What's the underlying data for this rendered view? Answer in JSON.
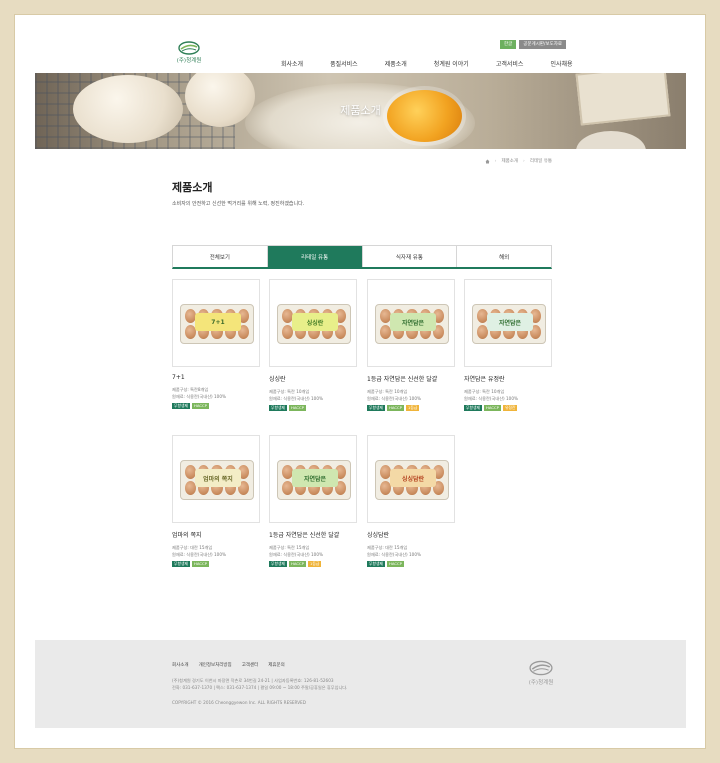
{
  "header": {
    "logo_text": "(주)청계원",
    "util": [
      "한글",
      "공문게시판/보도자료"
    ],
    "nav": [
      "회사소개",
      "품질서비스",
      "제품소개",
      "청계원 이야기",
      "고객서비스",
      "인사채용"
    ]
  },
  "hero": {
    "title": "제품소개"
  },
  "breadcrumb": {
    "home_icon": "home-icon",
    "items": [
      "제품소개",
      "리테일 유통"
    ]
  },
  "page": {
    "title": "제품소개",
    "description": "소비자의 안전하고 신선한 먹거리를 위해 노력, 정진하겠습니다."
  },
  "tabs": [
    {
      "label": "전체보기",
      "active": false
    },
    {
      "label": "리테일 유통",
      "active": true
    },
    {
      "label": "식자재 유통",
      "active": false
    },
    {
      "label": "해외",
      "active": false
    }
  ],
  "colors": {
    "accent": "#1f7a5c",
    "badge_green": "#1f7a5c",
    "badge_lightgreen": "#7cb65c",
    "badge_yellow": "#f0b43a"
  },
  "products": [
    {
      "name": "7+1",
      "info1": "제품구성: 특란8개입",
      "info2": "원재료: 식용란(국내산) 100%",
      "badges": [
        "무항생제",
        "HACCP"
      ],
      "label": "7+1",
      "label_bg": "#f4e57a",
      "label_color": "#3c6a2a"
    },
    {
      "name": "싱싱란",
      "info1": "제품구성: 특란 10개입",
      "info2": "원재료: 식용란(국내산) 100%",
      "badges": [
        "무항생제",
        "HACCP"
      ],
      "label": "싱싱란",
      "label_bg": "#e8ef8a",
      "label_color": "#3f7a23"
    },
    {
      "name": "1등급 자연담은 신선한 달걀",
      "info1": "제품구성: 특란 10개입",
      "info2": "원재료: 식용란(국내산) 100%",
      "badges": [
        "무항생제",
        "HACCP",
        "1등급"
      ],
      "label": "자연담은",
      "label_bg": "#cfe7b0",
      "label_color": "#2c6b2c"
    },
    {
      "name": "자연담은 유정란",
      "info1": "제품구성: 특란 10개입",
      "info2": "원재료: 식용란(국내산) 100%",
      "badges": [
        "무항생제",
        "HACCP",
        "유정란"
      ],
      "label": "자연담은",
      "label_bg": "#dff0e4",
      "label_color": "#2c6b2c"
    },
    {
      "name": "엄마의 쪽지",
      "info1": "제품구성: 대란 15개입",
      "info2": "원재료: 식용란(국내산) 100%",
      "badges": [
        "무항생제",
        "HACCP"
      ],
      "label": "엄마의 쪽지",
      "label_bg": "#f3edc6",
      "label_color": "#6b6a2a"
    },
    {
      "name": "1등급 자연담은 신선한 달걀",
      "info1": "제품구성: 특란 15개입",
      "info2": "원재료: 식용란(국내산) 100%",
      "badges": [
        "무항생제",
        "HACCP",
        "1등급"
      ],
      "label": "자연담은",
      "label_bg": "#cfe7b0",
      "label_color": "#2c6b2c"
    },
    {
      "name": "싱싱담란",
      "info1": "제품구성: 대란 15개입",
      "info2": "원재료: 식용란(국내산) 100%",
      "badges": [
        "무항생제",
        "HACCP"
      ],
      "label": "싱싱담란",
      "label_bg": "#f4d9a6",
      "label_color": "#b4421f"
    }
  ],
  "footer": {
    "links": [
      "회사소개",
      "개인정보처리방침",
      "고객센터",
      "제휴문의"
    ],
    "address": "(주)청계원 경기도 이천시 마장면 작촌로 34번길 24-21 | 사업자등록번호: 126-81-52603",
    "contact": "전화: 031-637-1370 | 팩스: 031-637-1374 | 평일 09:00 ~ 18:00 주말/공휴일은 휴무입니다.",
    "copyright": "COPYRIGHT © 2016 Cheonggyewon Inc. ALL RIGHTS RESERVED",
    "logo_text": "(주)청계원"
  }
}
